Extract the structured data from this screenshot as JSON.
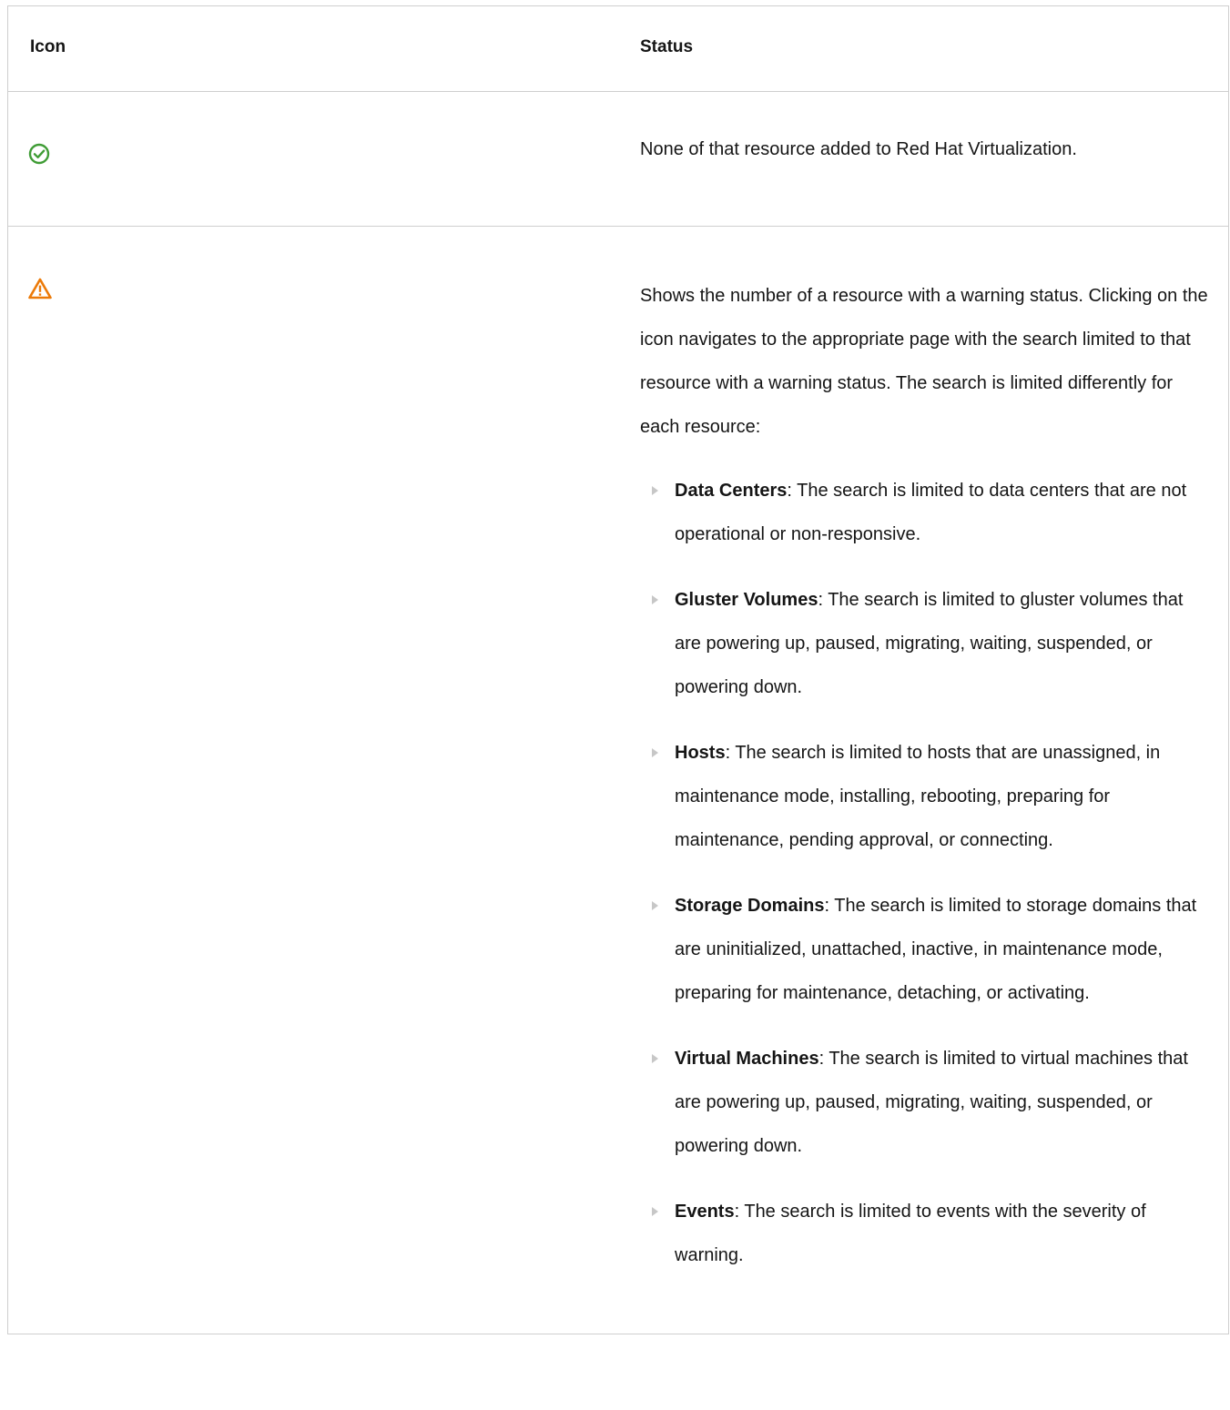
{
  "table": {
    "headers": {
      "icon": "Icon",
      "status": "Status"
    },
    "rows": [
      {
        "icon_name": "check-circle-icon",
        "icon_color": "#3f9c35",
        "status_text": "None of that resource added to Red Hat Virtualization."
      },
      {
        "icon_name": "warning-triangle-icon",
        "icon_color": "#ec7a08",
        "status_text": "Shows the number of a resource with a warning status. Clicking on the icon navigates to the appropriate page with the search limited to that resource with a warning status. The search is limited differently for each resource:",
        "items": [
          {
            "term": "Data Centers",
            "text": ": The search is limited to data centers that are not operational or non-responsive."
          },
          {
            "term": "Gluster Volumes",
            "text": ": The search is limited to gluster volumes that are powering up, paused, migrating, waiting, suspended, or powering down."
          },
          {
            "term": "Hosts",
            "text": ": The search is limited to hosts that are unassigned, in maintenance mode, installing, rebooting, preparing for maintenance, pending approval, or connecting."
          },
          {
            "term": "Storage Domains",
            "text": ": The search is limited to storage domains that are uninitialized, unattached, inactive, in maintenance mode, preparing for maintenance, detaching, or activating."
          },
          {
            "term": "Virtual Machines",
            "text": ": The search is limited to virtual machines that are powering up, paused, migrating, waiting, suspended, or powering down."
          },
          {
            "term": "Events",
            "text": ": The search is limited to events with the severity of warning."
          }
        ]
      }
    ]
  }
}
